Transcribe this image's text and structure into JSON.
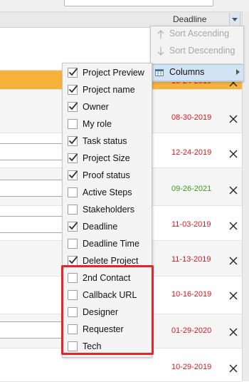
{
  "header": {
    "column_label": "Deadline"
  },
  "sort_menu": {
    "sort_ascending": "Sort Ascending",
    "sort_descending": "Sort Descending",
    "columns": "Columns"
  },
  "columns_menu": {
    "items": [
      {
        "label": "Project Preview",
        "checked": true
      },
      {
        "label": "Project name",
        "checked": true
      },
      {
        "label": "Owner",
        "checked": true
      },
      {
        "label": "My role",
        "checked": false
      },
      {
        "label": "Task status",
        "checked": true
      },
      {
        "label": "Project Size",
        "checked": true
      },
      {
        "label": "Proof status",
        "checked": true
      },
      {
        "label": "Active Steps",
        "checked": false
      },
      {
        "label": "Stakeholders",
        "checked": false
      },
      {
        "label": "Deadline",
        "checked": true
      },
      {
        "label": "Deadline Time",
        "checked": false
      },
      {
        "label": "Delete Project",
        "checked": true
      },
      {
        "label": "2nd Contact",
        "checked": false
      },
      {
        "label": "Callback URL",
        "checked": false
      },
      {
        "label": "Designer",
        "checked": false
      },
      {
        "label": "Requester",
        "checked": false
      },
      {
        "label": "Tech",
        "checked": false
      }
    ]
  },
  "rows": [
    {
      "date": "10-24-2019",
      "color": "red"
    },
    {
      "date": "08-30-2019",
      "color": "red"
    },
    {
      "date": "12-24-2019",
      "color": "red"
    },
    {
      "date": "09-26-2021",
      "color": "green"
    },
    {
      "date": "11-03-2019",
      "color": "red"
    },
    {
      "date": "11-13-2019",
      "color": "red"
    },
    {
      "date": "10-16-2019",
      "color": "red"
    },
    {
      "date": "01-29-2020",
      "color": "red"
    },
    {
      "date": "10-29-2019",
      "color": "red"
    }
  ],
  "colors": {
    "overdue": "#d8191f",
    "ontime": "#3c9a1c",
    "highlight_row": "#f7b23b",
    "annotation_box": "#e8242b"
  }
}
